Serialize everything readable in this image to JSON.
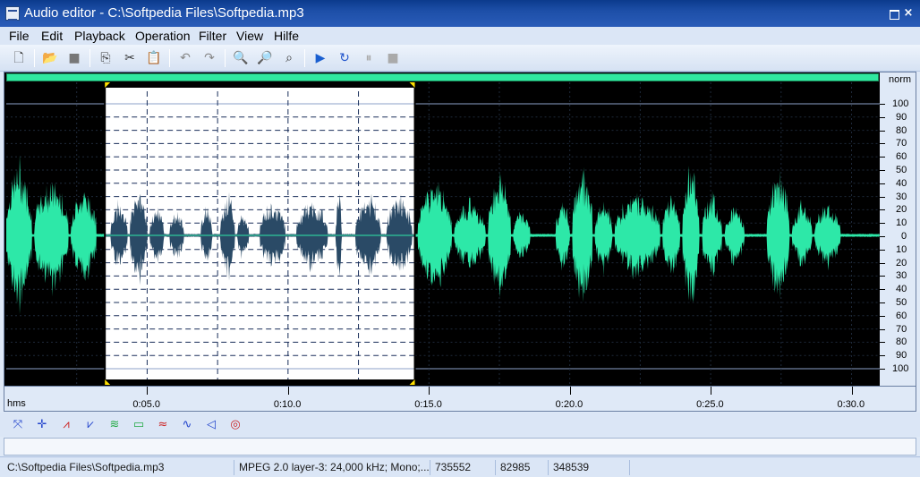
{
  "window": {
    "title": "Audio editor - C:\\Softpedia Files\\Softpedia.mp3",
    "maximize_label": "",
    "close_label": "×"
  },
  "menu": [
    "File",
    "Edit",
    "Playback",
    "Operation",
    "Filter",
    "View",
    "Hilfe"
  ],
  "toolbar": {
    "buttons": [
      {
        "name": "new-file-icon",
        "glyph": "🗋"
      },
      {
        "name": "open-folder-icon",
        "glyph": "📂"
      },
      {
        "name": "save-icon",
        "glyph": "■"
      },
      {
        "name": "copy-icon",
        "glyph": "⎘"
      },
      {
        "name": "cut-icon",
        "glyph": "✂"
      },
      {
        "name": "paste-icon",
        "glyph": "📋"
      },
      {
        "name": "undo-icon",
        "glyph": "↶"
      },
      {
        "name": "redo-icon",
        "glyph": "↷"
      },
      {
        "name": "zoom-in-icon",
        "glyph": "🔍"
      },
      {
        "name": "zoom-out-icon",
        "glyph": "🔎"
      },
      {
        "name": "zoom-fit-icon",
        "glyph": "⌕"
      },
      {
        "name": "play-icon",
        "glyph": "▶"
      },
      {
        "name": "loop-play-icon",
        "glyph": "↻"
      },
      {
        "name": "pause-icon",
        "glyph": "⏸"
      },
      {
        "name": "stop-icon",
        "glyph": "■"
      }
    ]
  },
  "waveform": {
    "scale_label": "norm",
    "y_ticks": [
      "100",
      "90",
      "80",
      "70",
      "60",
      "50",
      "40",
      "30",
      "20",
      "10",
      "0",
      "10",
      "20",
      "30",
      "40",
      "50",
      "60",
      "70",
      "80",
      "90",
      "100"
    ],
    "x_axis_label": "hms",
    "x_ticks": [
      "0:05.0",
      "0:10.0",
      "0:15.0",
      "0:20.0",
      "0:25.0",
      "0:30.0"
    ],
    "selection": {
      "start_seconds": 3.5,
      "end_seconds": 14.5
    },
    "duration_seconds": 31.0,
    "colors": {
      "background": "#000000",
      "wave": "#2de8a8",
      "selected_background": "#ffffff",
      "selected_wave": "#2a4a66",
      "scroll_strip": "#30e8a0"
    }
  },
  "effects": [
    {
      "name": "normalize-icon",
      "glyph": "⤧",
      "color": "#2244cc"
    },
    {
      "name": "center-icon",
      "glyph": "✛",
      "color": "#2244cc"
    },
    {
      "name": "fade-in-icon",
      "glyph": "⩘",
      "color": "#cc2222"
    },
    {
      "name": "fade-out-icon",
      "glyph": "⩗",
      "color": "#2244cc"
    },
    {
      "name": "amplify-icon",
      "glyph": "≋",
      "color": "#22aa44"
    },
    {
      "name": "silence-icon",
      "glyph": "▭",
      "color": "#22aa44"
    },
    {
      "name": "reverse-icon",
      "glyph": "≈",
      "color": "#cc2222"
    },
    {
      "name": "echo-icon",
      "glyph": "∿",
      "color": "#2244cc"
    },
    {
      "name": "noise-icon",
      "glyph": "◁",
      "color": "#2244cc"
    },
    {
      "name": "stereo-icon",
      "glyph": "◎",
      "color": "#cc2222"
    }
  ],
  "status": {
    "file": "C:\\Softpedia Files\\Softpedia.mp3",
    "format": "MPEG 2.0 layer-3: 24,000 kHz; Mono;...",
    "total_samples": "735552",
    "selection_start": "82985",
    "selection_end": "348539"
  }
}
